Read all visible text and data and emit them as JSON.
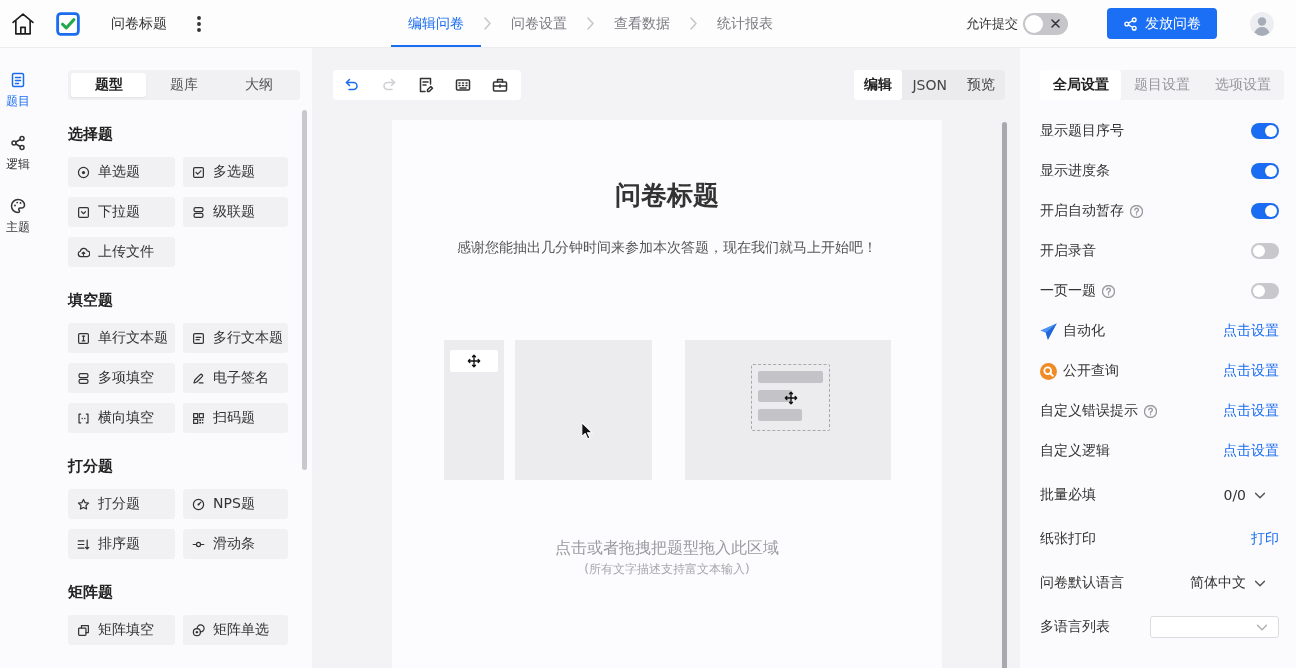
{
  "top_bar": {
    "title": "问卷标题",
    "steps": [
      {
        "label": "编辑问卷",
        "selected": true
      },
      {
        "label": "问卷设置",
        "selected": false
      },
      {
        "label": "查看数据",
        "selected": false
      },
      {
        "label": "统计报表",
        "selected": false
      }
    ],
    "allow_submit": {
      "label": "允许提交",
      "on": false
    },
    "publish_button": "发放问卷"
  },
  "rail": {
    "items": [
      {
        "kind": "questions",
        "label": "题目",
        "selected": true
      },
      {
        "kind": "logic",
        "label": "逻辑",
        "selected": false
      },
      {
        "kind": "theme",
        "label": "主题",
        "selected": false
      }
    ]
  },
  "question_panel": {
    "tabs": [
      {
        "label": "题型",
        "selected": true
      },
      {
        "label": "题库",
        "selected": false
      },
      {
        "label": "大纲",
        "selected": false
      }
    ],
    "groups": [
      {
        "title": "选择题",
        "items": [
          {
            "kind": "radio",
            "label": "单选题"
          },
          {
            "kind": "checkbox",
            "label": "多选题"
          },
          {
            "kind": "dropdown",
            "label": "下拉题"
          },
          {
            "kind": "cascade",
            "label": "级联题"
          },
          {
            "kind": "upload",
            "label": "上传文件"
          }
        ]
      },
      {
        "title": "填空题",
        "items": [
          {
            "kind": "single_line",
            "label": "单行文本题"
          },
          {
            "kind": "multi_line",
            "label": "多行文本题"
          },
          {
            "kind": "multi_fill",
            "label": "多项填空"
          },
          {
            "kind": "signature",
            "label": "电子签名"
          },
          {
            "kind": "inline_fill",
            "label": "横向填空"
          },
          {
            "kind": "scan",
            "label": "扫码题"
          }
        ]
      },
      {
        "title": "打分题",
        "items": [
          {
            "kind": "rating",
            "label": "打分题"
          },
          {
            "kind": "nps",
            "label": "NPS题"
          },
          {
            "kind": "ranking",
            "label": "排序题"
          },
          {
            "kind": "slider",
            "label": "滑动条"
          }
        ]
      },
      {
        "title": "矩阵题",
        "items": [
          {
            "kind": "matrix_fill",
            "label": "矩阵填空"
          },
          {
            "kind": "matrix_radio",
            "label": "矩阵单选"
          }
        ]
      }
    ]
  },
  "editor": {
    "tools": [
      {
        "kind": "undo",
        "disabled": false
      },
      {
        "kind": "redo",
        "disabled": true
      },
      {
        "kind": "form",
        "disabled": false
      },
      {
        "kind": "keyboard",
        "disabled": false
      },
      {
        "kind": "toolbox",
        "disabled": false
      }
    ],
    "view_tabs": [
      {
        "label": "编辑",
        "selected": true
      },
      {
        "label": "JSON",
        "selected": false
      },
      {
        "label": "预览",
        "selected": false
      }
    ],
    "survey": {
      "title": "问卷标题",
      "description": "感谢您能抽出几分钟时间来参加本次答题，现在我们就马上开始吧！",
      "drop_hint": "点击或者拖拽把题型拖入此区域",
      "drop_note": "(所有文字描述支持富文本输入)"
    }
  },
  "settings": {
    "tabs": [
      {
        "label": "全局设置",
        "selected": true,
        "disabled": false
      },
      {
        "label": "题目设置",
        "selected": false,
        "disabled": true
      },
      {
        "label": "选项设置",
        "selected": false,
        "disabled": true
      }
    ],
    "rows": [
      {
        "kind": "toggle",
        "label": "显示题目序号",
        "help": false,
        "on": true
      },
      {
        "kind": "toggle",
        "label": "显示进度条",
        "help": false,
        "on": true
      },
      {
        "kind": "toggle",
        "label": "开启自动暂存",
        "help": true,
        "on": true
      },
      {
        "kind": "toggle",
        "label": "开启录音",
        "help": false,
        "on": false
      },
      {
        "kind": "toggle",
        "label": "一页一题",
        "help": true,
        "on": false
      },
      {
        "kind": "automation",
        "label": "自动化",
        "help": false,
        "link": "点击设置"
      },
      {
        "kind": "query",
        "label": "公开查询",
        "help": false,
        "link": "点击设置"
      },
      {
        "kind": "link",
        "label": "自定义错误提示",
        "help": true,
        "link": "点击设置"
      },
      {
        "kind": "link",
        "label": "自定义逻辑",
        "help": false,
        "link": "点击设置"
      },
      {
        "kind": "select",
        "label": "批量必填",
        "help": false,
        "value": "0/0"
      },
      {
        "kind": "link",
        "label": "纸张打印",
        "help": false,
        "link": "打印"
      },
      {
        "kind": "select",
        "label": "问卷默认语言",
        "help": false,
        "value": "简体中文"
      },
      {
        "kind": "multiselect",
        "label": "多语言列表",
        "help": false
      }
    ]
  }
}
